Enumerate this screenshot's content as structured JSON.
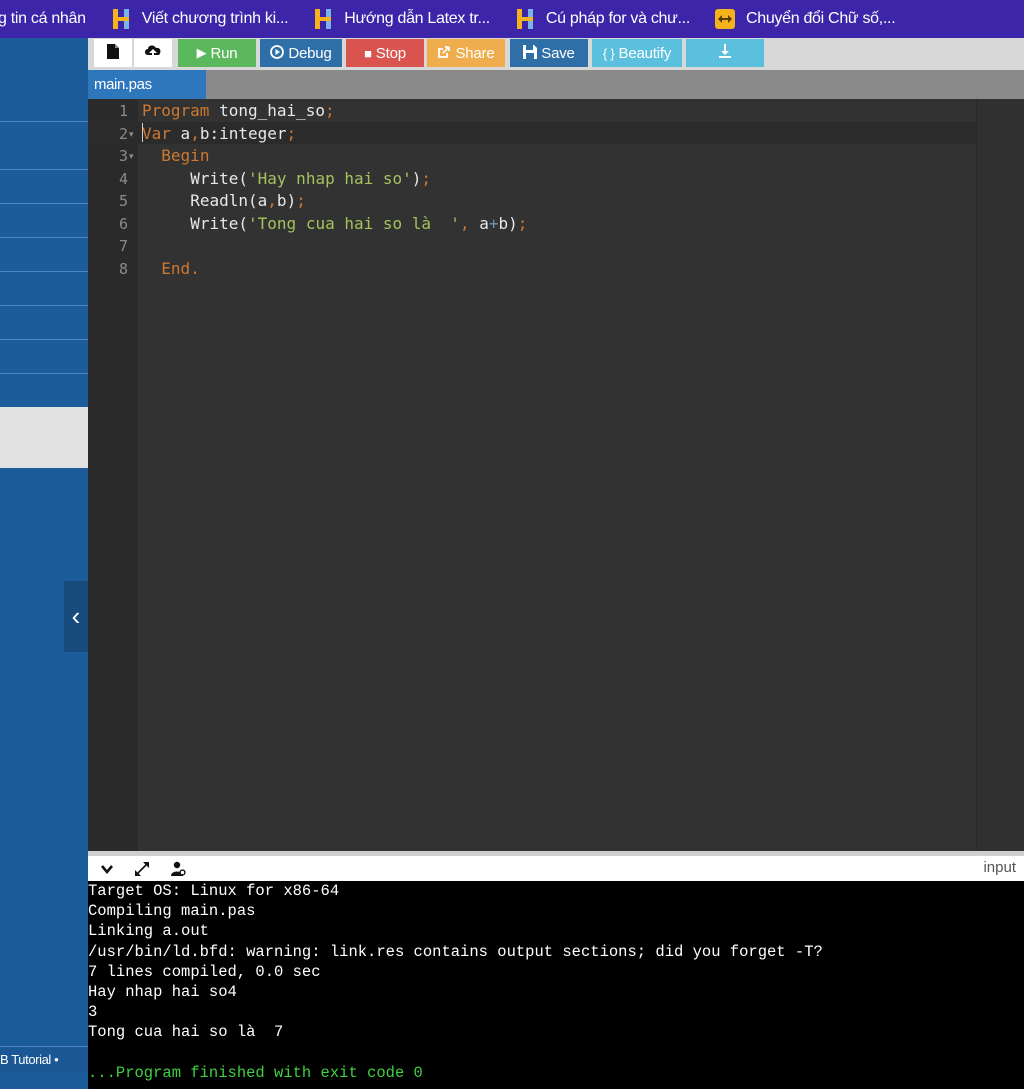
{
  "bookmarks": [
    {
      "label": "g tin cá nhân",
      "icon": "none"
    },
    {
      "label": "Viết chương trình ki...",
      "icon": "h-logo-icon"
    },
    {
      "label": "Hướng dẫn Latex tr...",
      "icon": "h-logo-icon"
    },
    {
      "label": "Cú pháp for và chư...",
      "icon": "h-logo-icon"
    },
    {
      "label": "Chuyển đổi Chữ số,...",
      "icon": "convert-icon"
    }
  ],
  "colors": {
    "bookmark_bar": "#3c25a8",
    "sidebar": "#1d5c9b",
    "run": "#5cb85c",
    "debug": "#2f6fa8",
    "stop": "#d9534f",
    "share": "#f0ad4e",
    "save": "#2f6fa8",
    "beautify": "#5bc0de",
    "download": "#5bc0de",
    "file_tab": "#2e77bd"
  },
  "toolbar": {
    "new_icon": "new-file-icon",
    "upload_icon": "upload-icon",
    "run": "Run",
    "debug": "Debug",
    "stop": "Stop",
    "share": "Share",
    "save": "Save",
    "beautify": "Beautify",
    "download_icon": "download-icon"
  },
  "file_tab": "main.pas",
  "editor": {
    "line_numbers": [
      "1",
      "2",
      "3",
      "4",
      "5",
      "6",
      "7",
      "8"
    ],
    "lines": [
      "Program tong_hai_so;",
      "Var a,b:integer;",
      "  Begin",
      "     Write('Hay nhap hai so');",
      "     Readln(a,b);",
      "     Write('Tong cua hai so là  ', a+b);",
      "",
      "  End."
    ]
  },
  "output_bar": {
    "input_label": "input"
  },
  "console": [
    "Target OS: Linux for x86-64",
    "Compiling main.pas",
    "Linking a.out",
    "/usr/bin/ld.bfd: warning: link.res contains output sections; did you forget -T?",
    "7 lines compiled, 0.0 sec",
    "Hay nhap hai so4",
    "3",
    "Tong cua hai so là  7",
    "",
    "...Program finished with exit code 0"
  ],
  "sidebar": {
    "footer": "B Tutorial •"
  }
}
